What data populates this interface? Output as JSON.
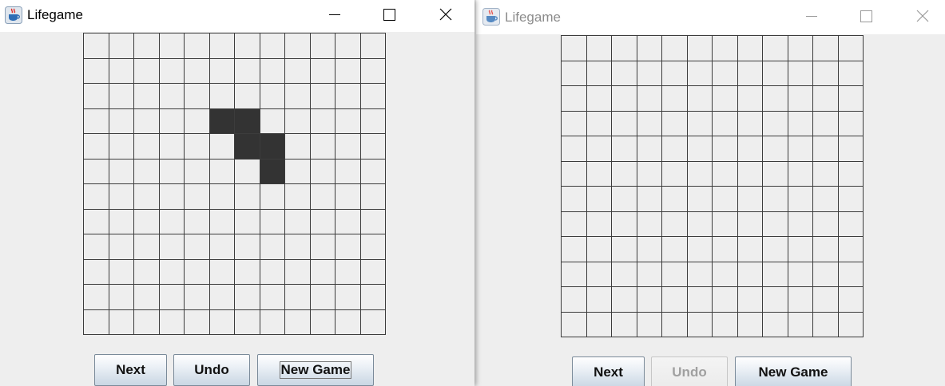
{
  "windows": [
    {
      "title": "Lifegame",
      "active": true,
      "buttons": {
        "next": "Next",
        "undo": "Undo",
        "new_game": "New Game"
      },
      "grid": {
        "rows": 12,
        "cols": 12,
        "alive": [
          [
            3,
            5
          ],
          [
            3,
            6
          ],
          [
            4,
            6
          ],
          [
            4,
            7
          ],
          [
            5,
            7
          ]
        ]
      }
    },
    {
      "title": "Lifegame",
      "active": false,
      "buttons": {
        "next": "Next",
        "undo": "Undo",
        "new_game": "New Game"
      },
      "undo_disabled": true,
      "grid": {
        "rows": 12,
        "cols": 12,
        "alive": []
      }
    }
  ],
  "icons": [
    "java-cup-icon",
    "minimize-icon",
    "maximize-icon",
    "close-icon"
  ],
  "colors": {
    "alive_cell": "#333333",
    "grid_line": "#3c3c3c",
    "background": "#eeeeee",
    "inactive_title": "#8c8c8c"
  }
}
